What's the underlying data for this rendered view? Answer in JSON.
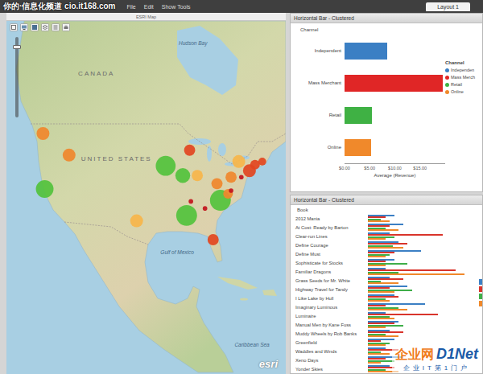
{
  "watermark": "你的·信息化频道 cio.it168.com",
  "menu": [
    "File",
    "Edit",
    "Show Tools"
  ],
  "tabs": [
    {
      "label": "Layout 1",
      "selected": true
    }
  ],
  "map": {
    "title": "ESRI Map",
    "zoom": {
      "level": 0.9
    },
    "logo": "esri",
    "labels": [
      {
        "text": "Hudson Bay",
        "kind": "water",
        "lon": -87.2,
        "lat": 64.0
      },
      {
        "text": "CANADA",
        "kind": "country",
        "lon": -109.8,
        "lat": 58.3
      },
      {
        "text": "UNITED STATES",
        "kind": "country",
        "lon": -105.1,
        "lat": 42.5
      },
      {
        "text": "Gulf of Mexico",
        "kind": "water",
        "lon": -90.9,
        "lat": 25.2
      },
      {
        "text": "Caribbean Sea",
        "kind": "water",
        "lon": -73.4,
        "lat": 8.05
      }
    ],
    "markers": [
      {
        "lon": -80.8,
        "lat": 35.2,
        "value": 42,
        "color": "#52c23c"
      },
      {
        "lon": -88.7,
        "lat": 32.4,
        "value": 42,
        "color": "#52c23c"
      },
      {
        "lon": -93.6,
        "lat": 41.6,
        "value": 38,
        "color": "#52c23c"
      },
      {
        "lon": -121.9,
        "lat": 37.3,
        "value": 30,
        "color": "#52c23c"
      },
      {
        "lon": -89.6,
        "lat": 39.8,
        "value": 21,
        "color": "#52c23c"
      },
      {
        "lon": -122.3,
        "lat": 47.6,
        "value": 16,
        "color": "#f0872d"
      },
      {
        "lon": -116.2,
        "lat": 43.6,
        "value": 16,
        "color": "#f0872d"
      },
      {
        "lon": -100.4,
        "lat": 31.4,
        "value": 16,
        "color": "#f7b54a"
      },
      {
        "lon": -76.5,
        "lat": 42.4,
        "value": 16,
        "color": "#f7b54a"
      },
      {
        "lon": -74.0,
        "lat": 40.7,
        "value": 16,
        "color": "#e2451f"
      },
      {
        "lon": -88.0,
        "lat": 44.5,
        "value": 12,
        "color": "#e2451f"
      },
      {
        "lon": -86.2,
        "lat": 39.8,
        "value": 12,
        "color": "#f7b54a"
      },
      {
        "lon": -81.6,
        "lat": 38.3,
        "value": 12,
        "color": "#f0872d"
      },
      {
        "lon": -78.3,
        "lat": 39.5,
        "value": 12,
        "color": "#f0872d"
      },
      {
        "lon": -82.5,
        "lat": 27.9,
        "value": 12,
        "color": "#e2451f"
      },
      {
        "lon": -72.7,
        "lat": 41.8,
        "value": 9,
        "color": "#e2451f"
      },
      {
        "lon": -79.0,
        "lat": 36.4,
        "value": 9,
        "color": "#f0872d"
      },
      {
        "lon": -71.0,
        "lat": 42.4,
        "value": 6,
        "color": "#e2451f"
      },
      {
        "lon": -75.9,
        "lat": 39.5,
        "value": 2,
        "color": "#c2121c"
      },
      {
        "lon": -78.3,
        "lat": 37.0,
        "value": 2,
        "color": "#c2121c"
      },
      {
        "lon": -87.7,
        "lat": 35.0,
        "value": 2,
        "color": "#c2121c"
      },
      {
        "lon": -84.4,
        "lat": 33.7,
        "value": 2,
        "color": "#c2121c"
      }
    ]
  },
  "channel_chart": {
    "title": "Horizontal Bar - Clustered",
    "axis_label": "Channel",
    "value_title": "Average (Revenue)",
    "max": 20,
    "ticks": [
      {
        "label": "$0.00",
        "value": 0
      },
      {
        "label": "$5.00",
        "value": 5
      },
      {
        "label": "$10.00",
        "value": 10
      },
      {
        "label": "$15.00",
        "value": 15
      }
    ],
    "legend_title": "Channel",
    "categories": [
      {
        "name": "Independent",
        "legend_label": "Independen",
        "value": 8.5,
        "color": "#3b7fc4"
      },
      {
        "name": "Mass Merchant",
        "legend_label": "Mass Merch",
        "value": 19.5,
        "color": "#e02626"
      },
      {
        "name": "Retail",
        "legend_label": "Retail",
        "value": 5.5,
        "color": "#3fb144"
      },
      {
        "name": "Online",
        "legend_label": "Online",
        "value": 5.2,
        "color": "#f0892b"
      }
    ]
  },
  "book_chart": {
    "title": "Horizontal Bar - Clustered",
    "axis_label": "Book",
    "max": 130,
    "books": [
      "2012 Mania",
      "At Cost: Ready by Barton",
      "Clear-run Lines",
      "Define Courage",
      "Define Must",
      "Sophisticate for Stocks",
      "Familiar Dragons",
      "Grass Seeds for Mr. White",
      "Highway Travel for Tandy",
      "I Like Lake by Hull",
      "Imaginary Luminous",
      "Luminaire",
      "Manual Men by Kane Fuss",
      "Muddy Wheels by Rob Banks",
      "Greenfield",
      "Waddles and Winds",
      "Xeno Days",
      "Yonder Skies"
    ],
    "series": [
      {
        "color": "#3b7fc4",
        "values": [
          30,
          40,
          25,
          35,
          60,
          30,
          20,
          25,
          45,
          30,
          65,
          20,
          35,
          25,
          30,
          20,
          40,
          25
        ]
      },
      {
        "color": "#d9342b",
        "values": [
          20,
          25,
          85,
          45,
          30,
          20,
          100,
          40,
          25,
          35,
          20,
          80,
          30,
          40,
          15,
          35,
          20,
          30
        ]
      },
      {
        "color": "#3fae49",
        "values": [
          15,
          20,
          30,
          28,
          25,
          45,
          35,
          15,
          50,
          20,
          35,
          25,
          40,
          20,
          25,
          15,
          30,
          20
        ]
      },
      {
        "color": "#f0892b",
        "values": [
          25,
          35,
          20,
          40,
          20,
          20,
          110,
          35,
          30,
          25,
          45,
          30,
          20,
          35,
          20,
          25,
          15,
          35
        ]
      }
    ]
  },
  "footer_watermark": {
    "brand": "企业网",
    "name": "D1Net",
    "tagline": "企业IT第1门户"
  }
}
